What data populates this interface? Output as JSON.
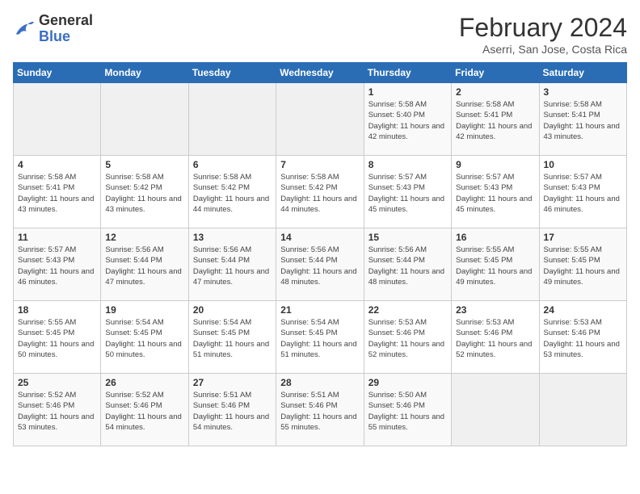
{
  "header": {
    "logo_line1": "General",
    "logo_line2": "Blue",
    "title": "February 2024",
    "subtitle": "Aserri, San Jose, Costa Rica"
  },
  "columns": [
    "Sunday",
    "Monday",
    "Tuesday",
    "Wednesday",
    "Thursday",
    "Friday",
    "Saturday"
  ],
  "weeks": [
    [
      {
        "day": "",
        "info": ""
      },
      {
        "day": "",
        "info": ""
      },
      {
        "day": "",
        "info": ""
      },
      {
        "day": "",
        "info": ""
      },
      {
        "day": "1",
        "info": "Sunrise: 5:58 AM\nSunset: 5:40 PM\nDaylight: 11 hours and 42 minutes."
      },
      {
        "day": "2",
        "info": "Sunrise: 5:58 AM\nSunset: 5:41 PM\nDaylight: 11 hours and 42 minutes."
      },
      {
        "day": "3",
        "info": "Sunrise: 5:58 AM\nSunset: 5:41 PM\nDaylight: 11 hours and 43 minutes."
      }
    ],
    [
      {
        "day": "4",
        "info": "Sunrise: 5:58 AM\nSunset: 5:41 PM\nDaylight: 11 hours and 43 minutes."
      },
      {
        "day": "5",
        "info": "Sunrise: 5:58 AM\nSunset: 5:42 PM\nDaylight: 11 hours and 43 minutes."
      },
      {
        "day": "6",
        "info": "Sunrise: 5:58 AM\nSunset: 5:42 PM\nDaylight: 11 hours and 44 minutes."
      },
      {
        "day": "7",
        "info": "Sunrise: 5:58 AM\nSunset: 5:42 PM\nDaylight: 11 hours and 44 minutes."
      },
      {
        "day": "8",
        "info": "Sunrise: 5:57 AM\nSunset: 5:43 PM\nDaylight: 11 hours and 45 minutes."
      },
      {
        "day": "9",
        "info": "Sunrise: 5:57 AM\nSunset: 5:43 PM\nDaylight: 11 hours and 45 minutes."
      },
      {
        "day": "10",
        "info": "Sunrise: 5:57 AM\nSunset: 5:43 PM\nDaylight: 11 hours and 46 minutes."
      }
    ],
    [
      {
        "day": "11",
        "info": "Sunrise: 5:57 AM\nSunset: 5:43 PM\nDaylight: 11 hours and 46 minutes."
      },
      {
        "day": "12",
        "info": "Sunrise: 5:56 AM\nSunset: 5:44 PM\nDaylight: 11 hours and 47 minutes."
      },
      {
        "day": "13",
        "info": "Sunrise: 5:56 AM\nSunset: 5:44 PM\nDaylight: 11 hours and 47 minutes."
      },
      {
        "day": "14",
        "info": "Sunrise: 5:56 AM\nSunset: 5:44 PM\nDaylight: 11 hours and 48 minutes."
      },
      {
        "day": "15",
        "info": "Sunrise: 5:56 AM\nSunset: 5:44 PM\nDaylight: 11 hours and 48 minutes."
      },
      {
        "day": "16",
        "info": "Sunrise: 5:55 AM\nSunset: 5:45 PM\nDaylight: 11 hours and 49 minutes."
      },
      {
        "day": "17",
        "info": "Sunrise: 5:55 AM\nSunset: 5:45 PM\nDaylight: 11 hours and 49 minutes."
      }
    ],
    [
      {
        "day": "18",
        "info": "Sunrise: 5:55 AM\nSunset: 5:45 PM\nDaylight: 11 hours and 50 minutes."
      },
      {
        "day": "19",
        "info": "Sunrise: 5:54 AM\nSunset: 5:45 PM\nDaylight: 11 hours and 50 minutes."
      },
      {
        "day": "20",
        "info": "Sunrise: 5:54 AM\nSunset: 5:45 PM\nDaylight: 11 hours and 51 minutes."
      },
      {
        "day": "21",
        "info": "Sunrise: 5:54 AM\nSunset: 5:45 PM\nDaylight: 11 hours and 51 minutes."
      },
      {
        "day": "22",
        "info": "Sunrise: 5:53 AM\nSunset: 5:46 PM\nDaylight: 11 hours and 52 minutes."
      },
      {
        "day": "23",
        "info": "Sunrise: 5:53 AM\nSunset: 5:46 PM\nDaylight: 11 hours and 52 minutes."
      },
      {
        "day": "24",
        "info": "Sunrise: 5:53 AM\nSunset: 5:46 PM\nDaylight: 11 hours and 53 minutes."
      }
    ],
    [
      {
        "day": "25",
        "info": "Sunrise: 5:52 AM\nSunset: 5:46 PM\nDaylight: 11 hours and 53 minutes."
      },
      {
        "day": "26",
        "info": "Sunrise: 5:52 AM\nSunset: 5:46 PM\nDaylight: 11 hours and 54 minutes."
      },
      {
        "day": "27",
        "info": "Sunrise: 5:51 AM\nSunset: 5:46 PM\nDaylight: 11 hours and 54 minutes."
      },
      {
        "day": "28",
        "info": "Sunrise: 5:51 AM\nSunset: 5:46 PM\nDaylight: 11 hours and 55 minutes."
      },
      {
        "day": "29",
        "info": "Sunrise: 5:50 AM\nSunset: 5:46 PM\nDaylight: 11 hours and 55 minutes."
      },
      {
        "day": "",
        "info": ""
      },
      {
        "day": "",
        "info": ""
      }
    ]
  ]
}
